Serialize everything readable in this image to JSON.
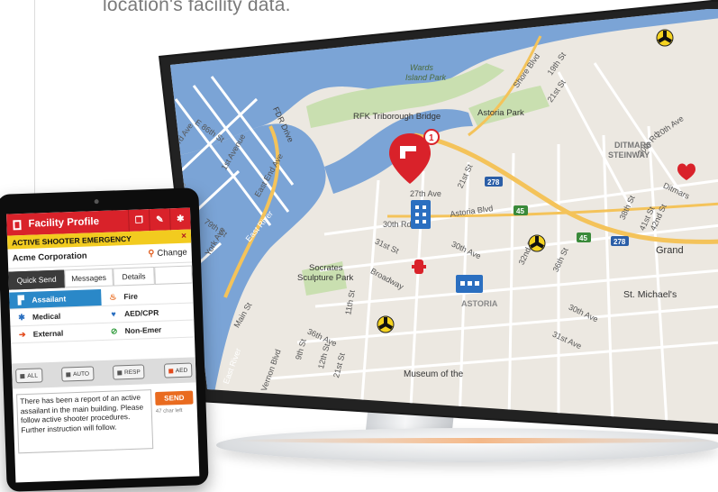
{
  "caption": "location's facility data.",
  "map": {
    "labels": {
      "wards_island": "Wards\nIsland Park",
      "rfk_bridge": "RFK Triborough Bridge",
      "astoria_park": "Astoria Park",
      "shore_blvd": "Shore Blvd",
      "st_19th": "19th St",
      "st_21st_top": "21st St",
      "st_20th_ave": "20th Ave",
      "st_20th_rd": "20th Rd",
      "ditmars": "DITMARS\nSTEINWAY",
      "fdr": "FDR Drive",
      "ave_3rd": "3rd Ave",
      "st_e86": "E 86th St",
      "ave_1st": "1st Avenue",
      "east_end": "East End Ave",
      "ave_27th": "27th Ave",
      "st_21st_mid": "21st St",
      "astoria_blvd": "Astoria Blvd",
      "hwy_278_a": "278",
      "hwy_45": "45",
      "hwy_45b": "45",
      "hwy_278_b": "278",
      "st_38th": "38th St",
      "st_41st": "41st St",
      "st_42nd": "42nd St",
      "ditmars_r": "Ditmars",
      "upper_side": "PER\nSIDE",
      "st_79th": "79th St",
      "york": "York Ave",
      "east_river_a": "East River",
      "rd_30th": "30th Rd",
      "ave_30th": "30th Ave",
      "st_31st_a": "31st St",
      "st_32nd": "32nd St",
      "st_36th_a": "36th St",
      "grand": "Grand",
      "socrates": "Socrates\nSculpture Park",
      "ave_31st": "31st Ave",
      "broadway": "Broadway",
      "st_11th": "11th St",
      "astoria_lbl": "ASTORIA",
      "st_michael": "St. Michael's",
      "main_st": "Main St",
      "ave_36th": "36th Ave",
      "st_9th": "9th St",
      "st_12th": "12th St",
      "st_21st_low": "21st St",
      "ave_30th_b": "30th Ave",
      "ave_31st_b": "31st Ave",
      "museum": "Museum of the",
      "east_river_b": "East River",
      "vernon": "Vernon Blvd",
      "alert_count": "1"
    },
    "colors": {
      "water": "#7ba4d6",
      "land": "#ece8e1",
      "park": "#c9dfb0",
      "road": "#ffffff",
      "highway": "#f4c35a",
      "pin": "#d9222a"
    }
  },
  "tablet": {
    "header_title": "Facility Profile",
    "alert_banner": "ACTIVE SHOOTER EMERGENCY",
    "alert_close": "×",
    "organization": "Acme Corporation",
    "change_label": "Change",
    "tabs": [
      "Quick Send",
      "Messages",
      "Details"
    ],
    "quick_send": [
      {
        "label": "Assailant",
        "icon": "gun-icon"
      },
      {
        "label": "Fire",
        "icon": "fire-icon"
      },
      {
        "label": "Medical",
        "icon": "medical-star-icon"
      },
      {
        "label": "AED/CPR",
        "icon": "heart-icon"
      },
      {
        "label": "External",
        "icon": "arrow-right-icon"
      },
      {
        "label": "Non-Emer",
        "icon": "circle-slash-icon"
      }
    ],
    "recipients": [
      "ALL",
      "AUTO",
      "RESP",
      "AED"
    ],
    "message": "There has been a report of an active assailant in the main building. Please follow active shooter procedures. Further instruction will follow.",
    "send_label": "SEND",
    "chars_left": "47 char left"
  }
}
